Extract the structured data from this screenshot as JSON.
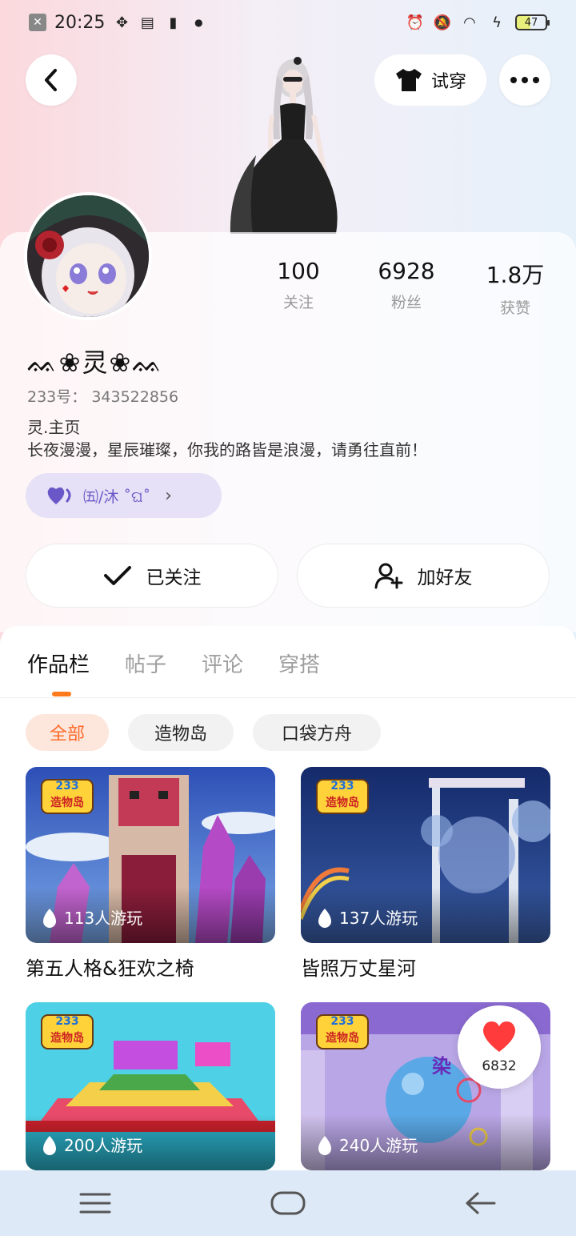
{
  "status_bar": {
    "time": "20:25",
    "battery": "47"
  },
  "header": {
    "try_on_label": "试穿",
    "back_icon": "chevron-left-icon",
    "more_icon": "more-dots-icon"
  },
  "profile": {
    "nickname": "ᨐ❀灵❀ᨐ",
    "uid_label": "233号：",
    "uid": "343522856",
    "bio_line1": "灵.主页",
    "bio_line2": "长夜漫漫，星辰璀璨，你我的路皆是浪漫，请勇往直前！",
    "tag_text": "㈤/沐 ˚ଘ˚"
  },
  "stats": [
    {
      "value": "100",
      "label": "关注"
    },
    {
      "value": "6928",
      "label": "粉丝"
    },
    {
      "value": "1.8万",
      "label": "获赞"
    }
  ],
  "actions": {
    "followed_label": "已关注",
    "add_friend_label": "加好友"
  },
  "tabs": [
    "作品栏",
    "帖子",
    "评论",
    "穿搭"
  ],
  "filters": [
    "全部",
    "造物岛",
    "口袋方舟"
  ],
  "cards": [
    {
      "badge_num": "233",
      "badge_text": "造物岛",
      "plays": "113人游玩",
      "title": "第五人格&狂欢之椅"
    },
    {
      "badge_num": "233",
      "badge_text": "造物岛",
      "plays": "137人游玩",
      "title": "皆照万丈星河"
    },
    {
      "badge_num": "233",
      "badge_text": "造物岛",
      "plays": "200人游玩",
      "title": ""
    },
    {
      "badge_num": "233",
      "badge_text": "造物岛",
      "plays": "240人游玩",
      "title": ""
    }
  ],
  "card4_overlay": "染",
  "like_bubble": {
    "count": "6832"
  },
  "colors": {
    "accent": "#ff7a1a",
    "tag_bg": "#e6e1f6",
    "tag_fg": "#6a57c8",
    "nav_bg": "#dde9f6"
  }
}
